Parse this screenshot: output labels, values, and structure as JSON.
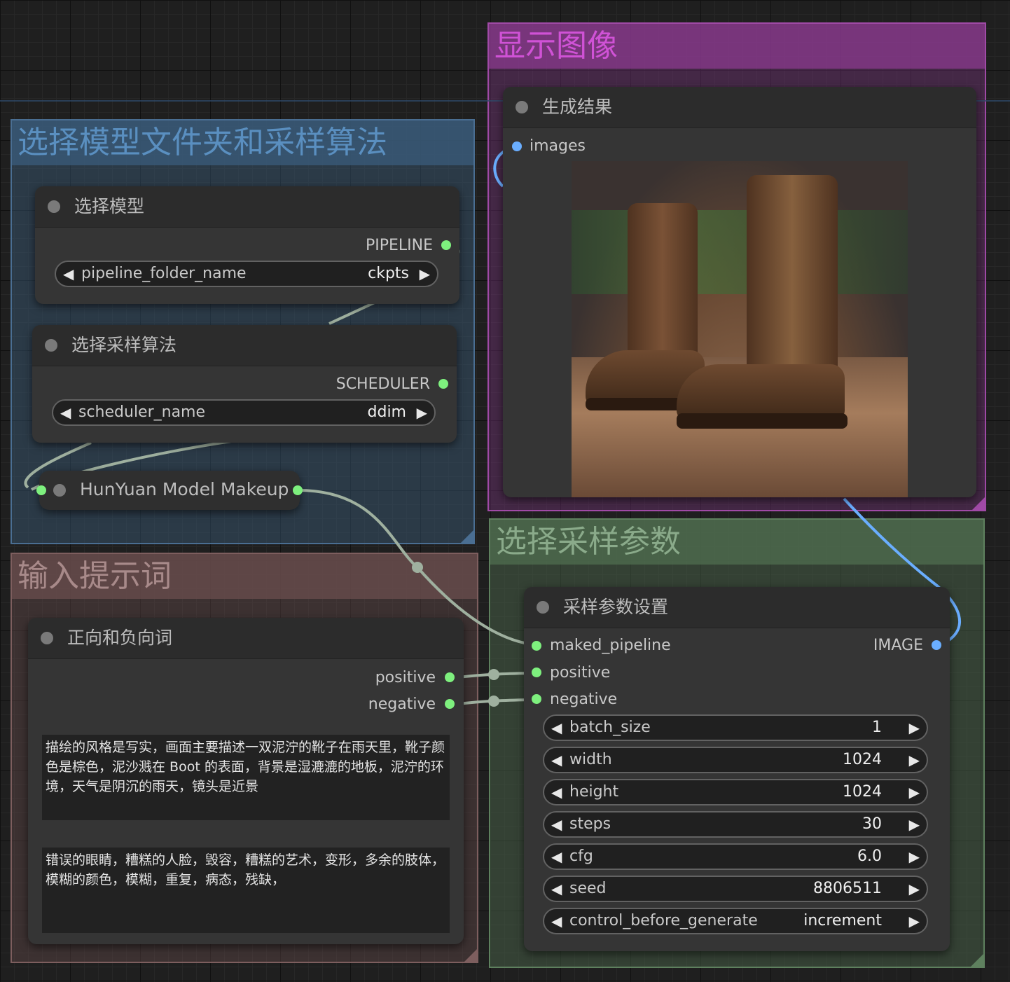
{
  "groups": {
    "display": {
      "title": "显示图像",
      "color": "#8a3a8e"
    },
    "model": {
      "title": "选择模型文件夹和采样算法",
      "color": "#3a5a78"
    },
    "prompt": {
      "title": "输入提示词",
      "color": "#6a4e4e"
    },
    "sampler": {
      "title": "选择采样参数",
      "color": "#4e6a4e"
    }
  },
  "nodes": {
    "preview": {
      "title": "生成结果",
      "input_images": "images",
      "image_description": "boots in rain"
    },
    "select_model": {
      "title": "选择模型",
      "output": "PIPELINE",
      "widget": {
        "name": "pipeline_folder_name",
        "value": "ckpts"
      }
    },
    "select_scheduler": {
      "title": "选择采样算法",
      "output": "SCHEDULER",
      "widget": {
        "name": "scheduler_name",
        "value": "ddim"
      }
    },
    "makeup": {
      "title": "HunYuan Model Makeup"
    },
    "prompts": {
      "title": "正向和负向词",
      "output_positive": "positive",
      "output_negative": "negative",
      "positive_text": "描绘的风格是写实，画面主要描述一双泥泞的靴子在雨天里，靴子颜色是棕色，泥沙溅在 Boot 的表面，背景是湿漉漉的地板，泥泞的环境，天气是阴沉的雨天，镜头是近景",
      "negative_text": "错误的眼睛，糟糕的人脸，毁容，糟糕的艺术，变形，多余的肢体，模糊的颜色，模糊，重复，病态，残缺，"
    },
    "sampler": {
      "title": "采样参数设置",
      "inputs": [
        "maked_pipeline",
        "positive",
        "negative"
      ],
      "output": "IMAGE",
      "widgets": [
        {
          "name": "batch_size",
          "value": "1"
        },
        {
          "name": "width",
          "value": "1024"
        },
        {
          "name": "height",
          "value": "1024"
        },
        {
          "name": "steps",
          "value": "30"
        },
        {
          "name": "cfg",
          "value": "6.0"
        },
        {
          "name": "seed",
          "value": "8806511"
        },
        {
          "name": "control_before_generate",
          "value": "increment"
        }
      ]
    }
  },
  "colors": {
    "link_green": "#9fb09f",
    "link_blue": "#6aaeff",
    "slot_green": "#7ef07e",
    "slot_blue": "#6aaeff"
  }
}
